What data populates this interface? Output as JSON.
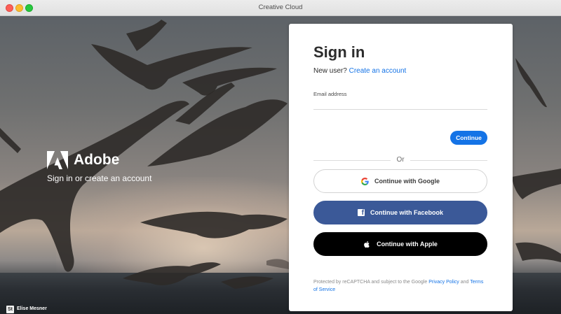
{
  "window": {
    "title": "Creative Cloud"
  },
  "brand": {
    "name": "Adobe",
    "tagline": "Sign in or create an account",
    "logo_color": "#ffffff"
  },
  "credit": {
    "badge": "St",
    "photographer": "Elise Mesner"
  },
  "signin": {
    "heading": "Sign in",
    "new_user_prompt": "New user?",
    "create_account_link": "Create an account",
    "email_label": "Email address",
    "email_value": "",
    "continue_label": "Continue",
    "or_text": "Or",
    "google_label": "Continue with Google",
    "facebook_label": "Continue with Facebook",
    "apple_label": "Continue with Apple",
    "recaptcha_prefix": "Protected by reCAPTCHA and subject to the Google",
    "privacy_link": "Privacy Policy",
    "and_text": "and",
    "terms_link": "Terms of Service"
  },
  "colors": {
    "accent": "#1473e6",
    "facebook": "#3b5998",
    "apple": "#000000",
    "close": "#fd5f57",
    "minimize": "#fdbc2e",
    "maximize": "#28c840"
  },
  "icons": {
    "google": "google-logo-icon",
    "facebook": "facebook-logo-icon",
    "apple": "apple-logo-icon",
    "adobe": "adobe-logo-icon"
  }
}
